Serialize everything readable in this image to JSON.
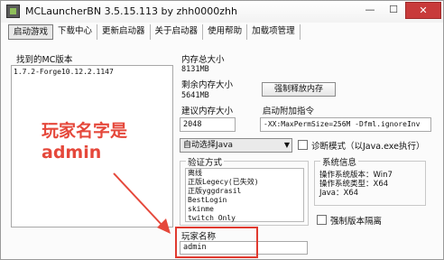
{
  "window": {
    "title": "MCLauncherBN 3.5.15.113  by zhh0000zhh",
    "min_label": "—",
    "max_label": "☐",
    "close_label": "✕"
  },
  "menu": [
    {
      "label": "启动游戏",
      "active": true
    },
    {
      "label": "下载中心"
    },
    {
      "label": "更新启动器"
    },
    {
      "label": "关于启动器"
    },
    {
      "label": "使用帮助"
    },
    {
      "label": "加载项管理"
    }
  ],
  "versions": {
    "label": "找到的MC版本",
    "items": [
      "1.7.2-Forge10.12.2.1147"
    ]
  },
  "memory": {
    "total_label": "内存总大小",
    "total_value": "8131MB",
    "remaining_label": "剩余内存大小",
    "remaining_value": "5641MB",
    "suggest_label": "建议内存大小",
    "memory_input": "2048",
    "release_button": "强制释放内存"
  },
  "launch_args": {
    "label": "启动附加指令",
    "value": "-XX:MaxPermSize=256M -Dfml.ignoreInv"
  },
  "java": {
    "selected": "自动选择Java",
    "debug_label": "诊断模式（以Java.exe执行）"
  },
  "auth": {
    "label": "验证方式",
    "items": [
      "离线",
      "正版Legecy(已失效)",
      "正版yggdrasil",
      "BestLogin",
      "skinme",
      "twitch Only"
    ]
  },
  "system": {
    "label": "系统信息",
    "os_version": "操作系统版本：Win7",
    "os_type": "操作系统类型：X64",
    "java": "Java：X64"
  },
  "isolation_label": "强制版本隔离",
  "player": {
    "label": "玩家名称",
    "value": "admin"
  },
  "annotation": {
    "line1": "玩家名字是",
    "line2": "admin"
  },
  "colors": {
    "annotation": "#e5483b",
    "close_button": "#c83a3a"
  }
}
